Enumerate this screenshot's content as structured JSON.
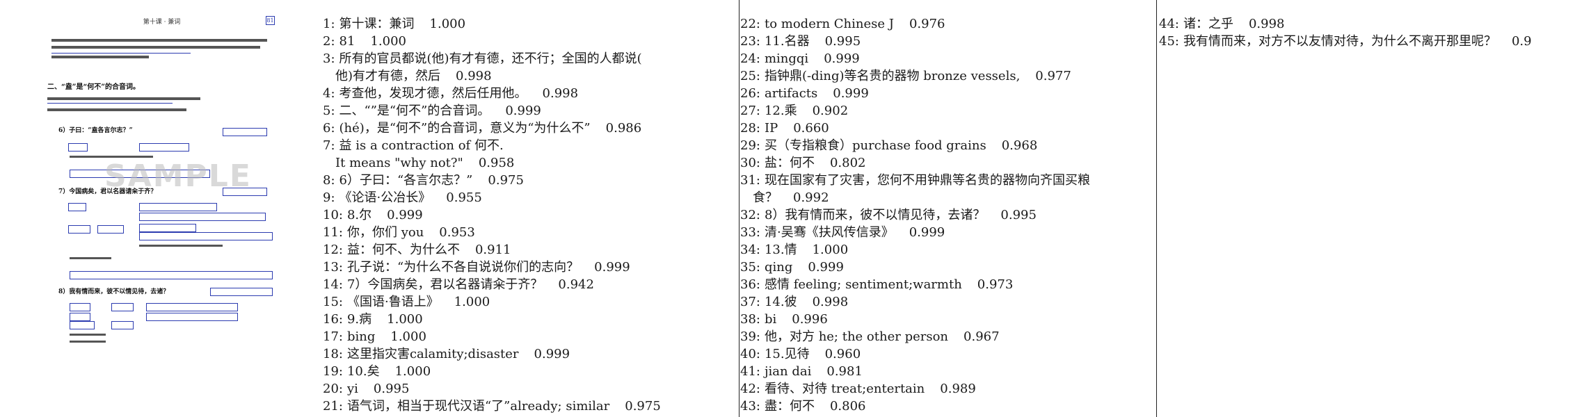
{
  "thumbnail": {
    "header": "第十课 · 兼词",
    "page_number": "81",
    "section_heading": "二、“盍”是“何不”的合音词。",
    "item6": "6）子曰：“盍各言尔志？”",
    "item7": "7）今国病矣，君以名器请籴于齐？",
    "item8": "8）我有情而来，彼不以情见待，去诸？",
    "watermark": "SAMPLE"
  },
  "column1": [
    {
      "n": "1:",
      "text": "第十课：兼词",
      "score": "1.000"
    },
    {
      "n": "2:",
      "text": "81",
      "score": "1.000"
    },
    {
      "n": "3:",
      "text": "所有的官员都说(他)有才有德，还不行；全国的人都说(",
      "cont": "他)有才有德，然后",
      "score": "0.998"
    },
    {
      "n": "4:",
      "text": "考查他，发现才德，然后任用他。",
      "score": "0.998"
    },
    {
      "n": "5:",
      "text": "二、“”是“何不”的合音词。",
      "score": "0.999"
    },
    {
      "n": "6:",
      "text": "(hé)，是“何不”的合音词，意义为“为什么不”",
      "score": "0.986"
    },
    {
      "n": "7:",
      "text": "益 is a contraction of 何不.",
      "cont": "It means \"why not?\"",
      "score": "0.958"
    },
    {
      "n": "8:",
      "text": "6）子曰：“各言尔志？”",
      "score": "0.975"
    },
    {
      "n": "9:",
      "text": "《论语·公冶长》",
      "score": "0.955"
    },
    {
      "n": "10:",
      "text": "8.尔",
      "score": "0.999"
    },
    {
      "n": "11:",
      "text": "你，你们 you",
      "score": "0.953"
    },
    {
      "n": "12:",
      "text": "益：何不、为什么不",
      "score": "0.911"
    },
    {
      "n": "13:",
      "text": "孔子说：“为什么不各自说说你们的志向？",
      "score": "0.999"
    },
    {
      "n": "14:",
      "text": "7）今国病矣，君以名器请籴于齐？",
      "score": "0.942"
    },
    {
      "n": "15:",
      "text": "《国语·鲁语上》",
      "score": "1.000"
    },
    {
      "n": "16:",
      "text": "9.病",
      "score": "1.000"
    },
    {
      "n": "17:",
      "text": "bing",
      "score": "1.000"
    },
    {
      "n": "18:",
      "text": "这里指灾害calamity;disaster",
      "score": "0.999"
    },
    {
      "n": "19:",
      "text": "10.矣",
      "score": "1.000"
    },
    {
      "n": "20:",
      "text": "yi",
      "score": "0.995"
    },
    {
      "n": "21:",
      "text": "语气词，相当于现代汉语“了”already; similar",
      "score": "0.975"
    }
  ],
  "column2": [
    {
      "n": "22:",
      "text": "to modern Chinese J",
      "score": "0.976"
    },
    {
      "n": "23:",
      "text": "11.名器",
      "score": "0.995"
    },
    {
      "n": "24:",
      "text": "mingqi",
      "score": "0.999"
    },
    {
      "n": "25:",
      "text": "指钟鼎(-ding)等名贵的器物 bronze vessels,",
      "score": "0.977"
    },
    {
      "n": "26:",
      "text": "artifacts",
      "score": "0.999"
    },
    {
      "n": "27:",
      "text": "12.乘",
      "score": "0.902"
    },
    {
      "n": "28:",
      "text": "IP",
      "score": "0.660"
    },
    {
      "n": "29:",
      "text": "买（专指粮食）purchase food grains",
      "score": "0.968"
    },
    {
      "n": "30:",
      "text": "盐：何不",
      "score": "0.802"
    },
    {
      "n": "31:",
      "text": "现在国家有了灾害，您何不用钟鼎等名贵的器物向齐国买粮",
      "cont": "食？",
      "score": "0.992"
    },
    {
      "n": "32:",
      "text": "8）我有情而来，彼不以情见待，去诸？",
      "score": "0.995"
    },
    {
      "n": "33:",
      "text": "清·吴骞《扶风传信录》",
      "score": "0.999"
    },
    {
      "n": "34:",
      "text": "13.情",
      "score": "1.000"
    },
    {
      "n": "35:",
      "text": "qing",
      "score": "0.999"
    },
    {
      "n": "36:",
      "text": "感情 feeling; sentiment;warmth",
      "score": "0.973"
    },
    {
      "n": "37:",
      "text": "14.彼",
      "score": "0.998"
    },
    {
      "n": "38:",
      "text": "bi",
      "score": "0.996"
    },
    {
      "n": "39:",
      "text": "他，对方 he; the other person",
      "score": "0.967"
    },
    {
      "n": "40:",
      "text": "15.见待",
      "score": "0.960"
    },
    {
      "n": "41:",
      "text": "jian dai",
      "score": "0.981"
    },
    {
      "n": "42:",
      "text": "看待、对待 treat;entertain",
      "score": "0.989"
    },
    {
      "n": "43:",
      "text": "盡：何不",
      "score": "0.806"
    }
  ],
  "column3": [
    {
      "n": "44:",
      "text": "诸：之乎",
      "score": "0.998"
    },
    {
      "n": "45:",
      "text": "我有情而来，对方不以友情对待，为什么不离开那里呢？",
      "score": "0.9"
    }
  ]
}
